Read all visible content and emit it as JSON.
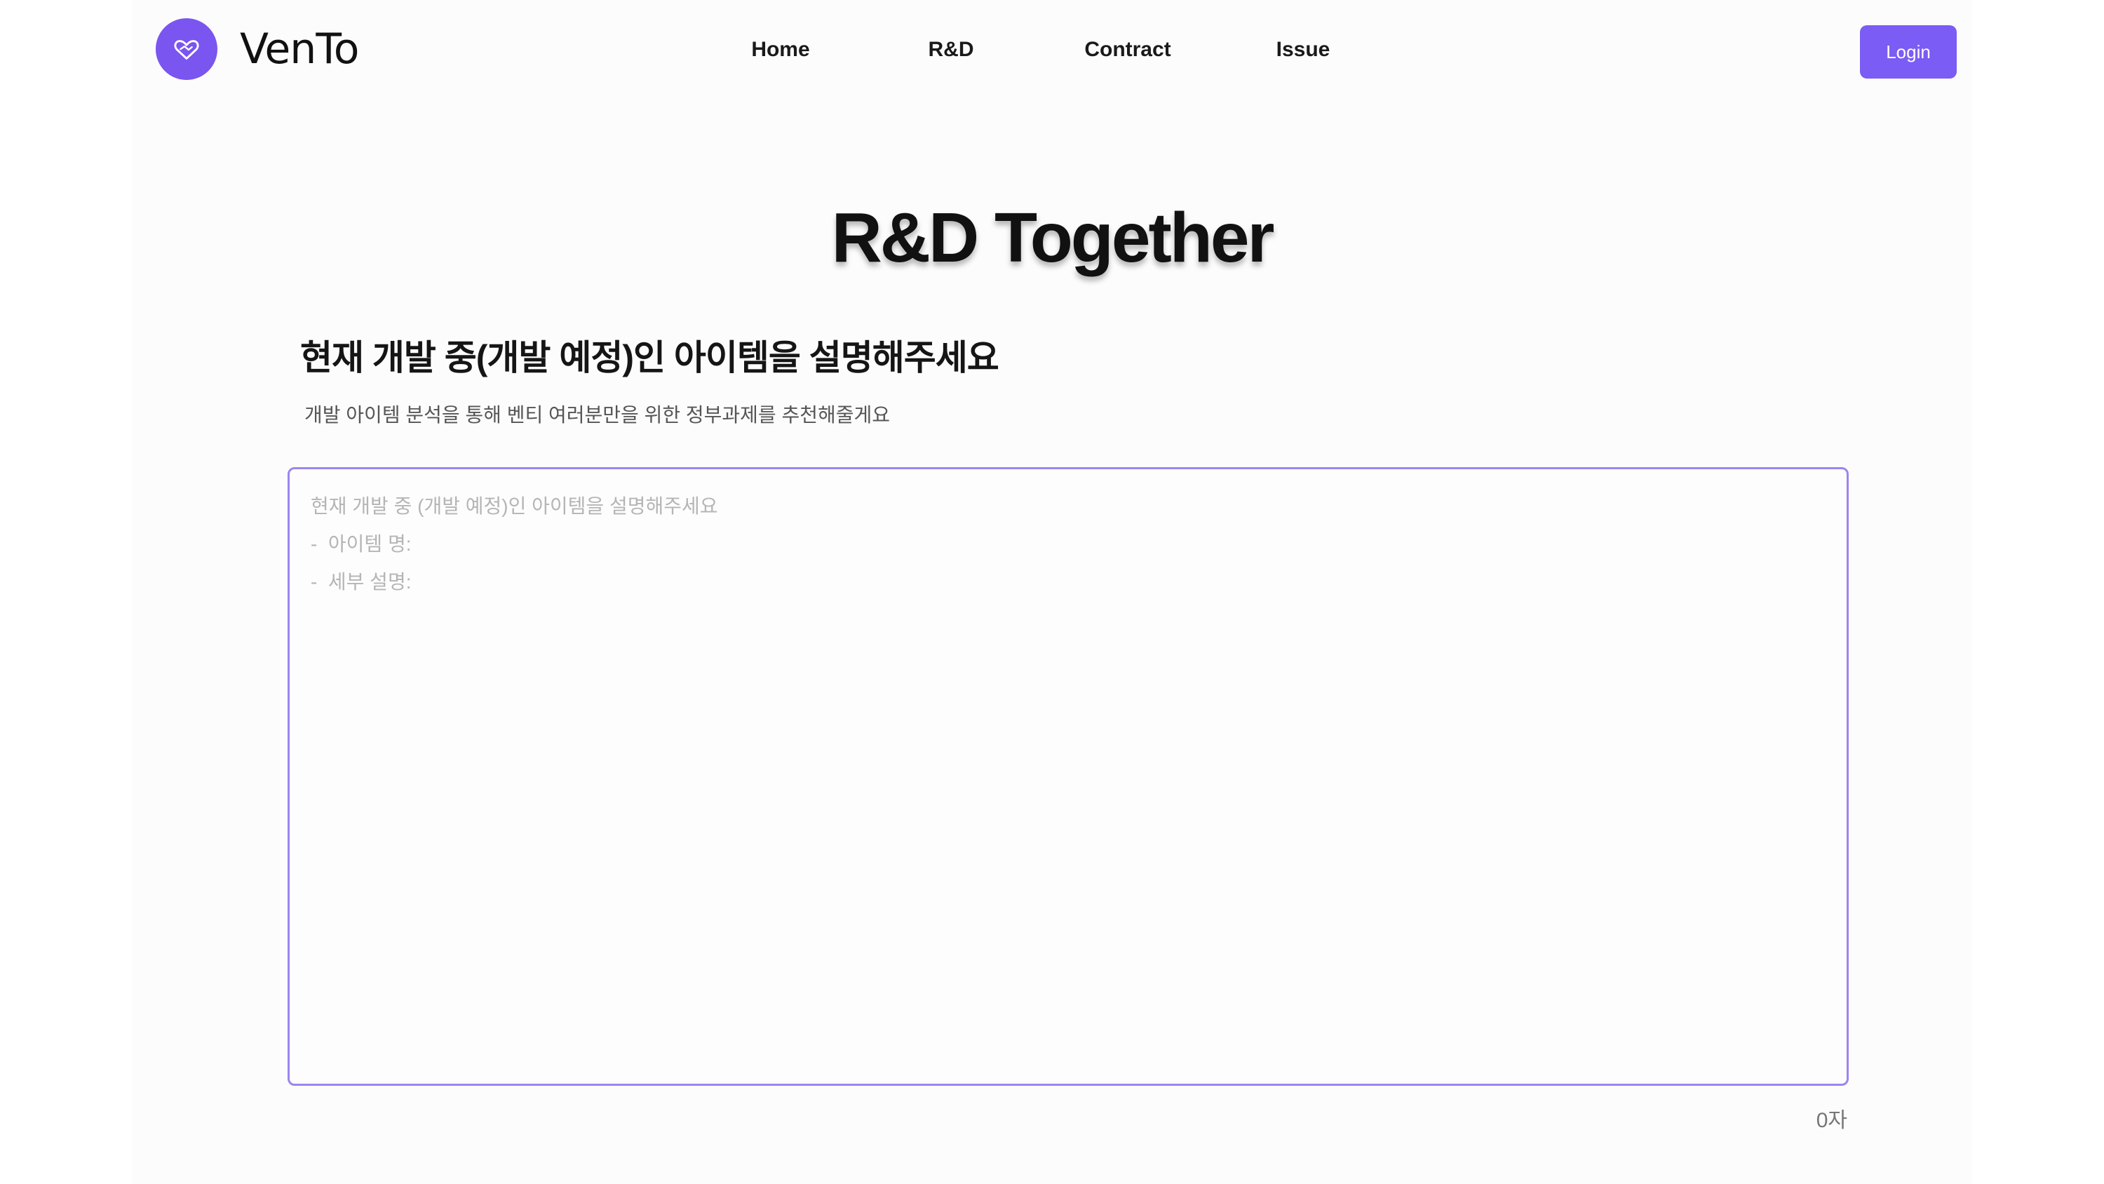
{
  "header": {
    "brand": "VenTo",
    "logo_icon": "heart-handshake-icon",
    "nav": [
      {
        "label": "Home"
      },
      {
        "label": "R&D"
      },
      {
        "label": "Contract"
      },
      {
        "label": "Issue"
      }
    ],
    "login_label": "Login"
  },
  "main": {
    "title": "R&D Together",
    "question": "현재 개발 중(개발 예정)인 아이템을 설명해주세요",
    "subtitle": "개발 아이템 분석을 통해 벤티 여러분만을 위한 정부과제를 추천해줄게요",
    "textarea": {
      "value": "",
      "placeholder": "현재 개발 중 (개발 예정)인 아이템을 설명해주세요\n-  아이템 명:\n-  세부 설명:"
    },
    "char_count": "0자"
  },
  "colors": {
    "accent": "#7b5cf4",
    "border": "#9b85f0"
  }
}
